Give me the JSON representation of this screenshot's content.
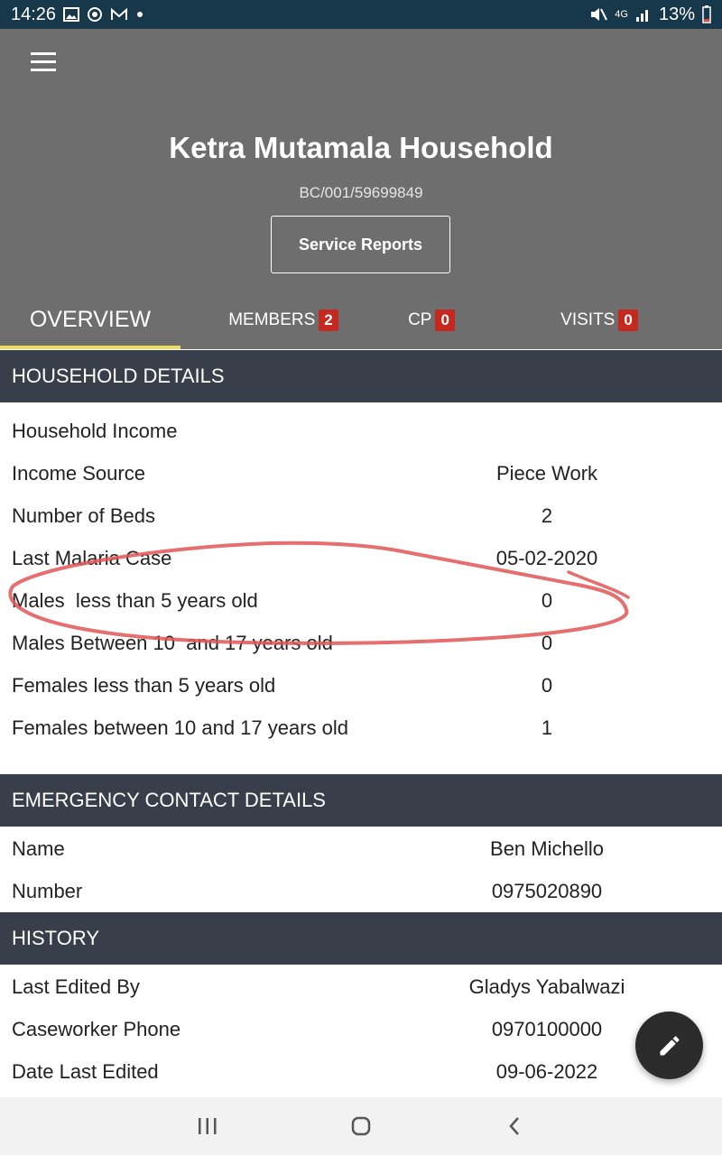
{
  "status_bar": {
    "time": "14:26",
    "battery": "13%",
    "network": "4G",
    "icons_left": [
      "gallery-icon",
      "sync-icon",
      "mail-icon",
      "dot-icon"
    ],
    "icons_right": [
      "mute-icon",
      "signal-icon",
      "battery-icon"
    ]
  },
  "header": {
    "menu_icon": "hamburger-icon",
    "title": "Ketra Mutamala Household",
    "subtitle": "BC/001/59699849",
    "service_reports_label": "Service Reports"
  },
  "tabs": [
    {
      "label": "OVERVIEW",
      "active": true
    },
    {
      "label": "MEMBERS",
      "badge": "2"
    },
    {
      "label": "CP",
      "badge": "0"
    },
    {
      "label": "VISITS",
      "badge": "0"
    }
  ],
  "household_details": {
    "title": "HOUSEHOLD DETAILS",
    "rows": [
      {
        "label": "Household Income",
        "value": ""
      },
      {
        "label": "Income Source",
        "value": "Piece Work"
      },
      {
        "label": "Number of Beds",
        "value": "2"
      },
      {
        "label": "Last Malaria Case",
        "value": "05-02-2020"
      },
      {
        "label": "Males  less than 5 years old",
        "value": "0"
      },
      {
        "label": "Males Between 10  and 17 years old",
        "value": "0"
      },
      {
        "label": "Females less than 5 years old",
        "value": "0"
      },
      {
        "label": "Females between 10 and 17 years old",
        "value": "1"
      }
    ]
  },
  "emergency_contact": {
    "title": "EMERGENCY CONTACT DETAILS",
    "rows": [
      {
        "label": "Name",
        "value": "Ben Michello"
      },
      {
        "label": "Number",
        "value": "0975020890"
      }
    ]
  },
  "history": {
    "title": "HISTORY",
    "rows": [
      {
        "label": "Last Edited By",
        "value": "Gladys Yabalwazi"
      },
      {
        "label": "Caseworker Phone",
        "value": "0970100000"
      },
      {
        "label": "Date Last Edited",
        "value": "09-06-2022"
      }
    ]
  },
  "fab_icon": "pencil-icon",
  "nav_bar": {
    "icons": [
      "recent-apps-icon",
      "home-icon",
      "back-icon"
    ]
  },
  "colors": {
    "status_bar": "#17384b",
    "header": "#6e6e6e",
    "section_header": "#383f4b",
    "badge": "#c4281f",
    "tab_indicator": "#e9dc5e",
    "annotation_stroke": "#e05555"
  }
}
